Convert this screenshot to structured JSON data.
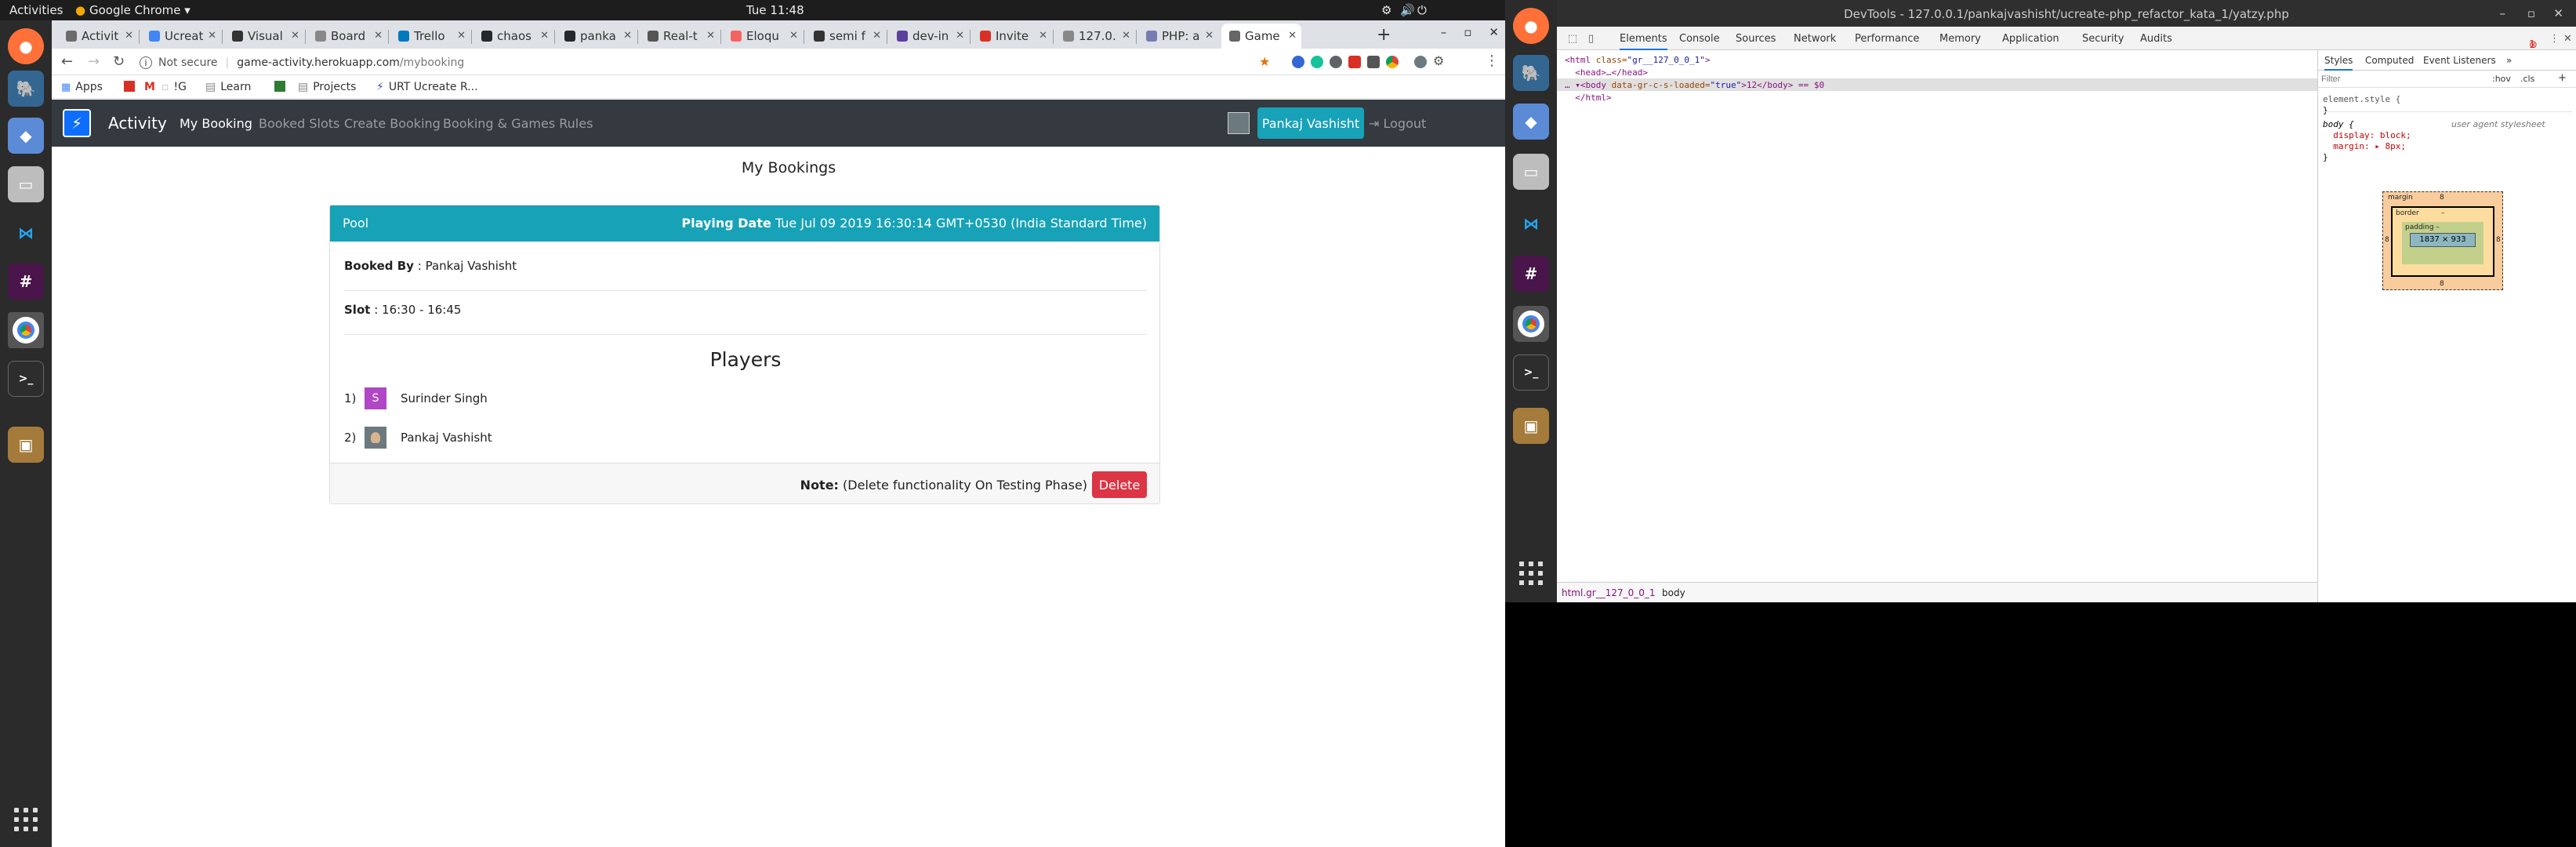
{
  "desktop": {
    "activities": "Activities",
    "app_menu": "Google Chrome ▾",
    "clock": "Tue 11:48"
  },
  "chrome": {
    "tabs": [
      {
        "label": "Activit",
        "color": "#6c6c6c"
      },
      {
        "label": "Ucreat",
        "color": "#4285f4"
      },
      {
        "label": "Visual",
        "color": "#333"
      },
      {
        "label": "Board",
        "color": "#888"
      },
      {
        "label": "Trello",
        "color": "#0079bf"
      },
      {
        "label": "chaos",
        "color": "#24292e"
      },
      {
        "label": "panka",
        "color": "#24292e"
      },
      {
        "label": "Real-t",
        "color": "#555"
      },
      {
        "label": "Eloqu",
        "color": "#f4645f"
      },
      {
        "label": "semi f",
        "color": "#333"
      },
      {
        "label": "dev-in",
        "color": "#5a3f9d"
      },
      {
        "label": "Invite",
        "color": "#d93025"
      },
      {
        "label": "127.0.",
        "color": "#888"
      },
      {
        "label": "PHP: a",
        "color": "#777bb3"
      },
      {
        "label": "Game",
        "color": "#666",
        "active": true
      }
    ],
    "url_security": "Not secure",
    "url_host": "game-activity.herokuapp.com",
    "url_path": "/mybooking",
    "bookmarks": [
      {
        "label": "Apps",
        "color": "#4285f4"
      },
      {
        "label": "",
        "color": "#d93025"
      },
      {
        "label": "",
        "color": "#d93025"
      },
      {
        "label": "!G",
        "color": "#999"
      },
      {
        "label": "Learn",
        "color": "#777"
      },
      {
        "label": "",
        "color": "#2e7d32"
      },
      {
        "label": "Projects",
        "color": "#777"
      },
      {
        "label": "URT Ucreate R...",
        "color": "#3f51b5"
      }
    ]
  },
  "app": {
    "brand": "Activity",
    "nav": [
      "My Booking",
      "Booked Slots",
      "Create Booking",
      "Booking & Games Rules"
    ],
    "user": "Pankaj Vashisht",
    "logout": "Logout",
    "page_title": "My Bookings",
    "booking": {
      "game": "Pool",
      "playing_date_label": "Playing Date",
      "playing_date": "Tue Jul 09 2019 16:30:14 GMT+0530 (India Standard Time)",
      "booked_by_label": "Booked By",
      "booked_by": ": Pankaj Vashisht",
      "slot_label": "Slot",
      "slot": ": 16:30 - 16:45",
      "players_heading": "Players",
      "players": [
        {
          "num": "1)",
          "initial": "S",
          "name": "Surinder Singh",
          "color": "#b047c4"
        },
        {
          "num": "2)",
          "initial": "",
          "name": "Pankaj Vashisht",
          "color": "#6c7a7f"
        }
      ],
      "note_label": "Note:",
      "note": "(Delete functionality On Testing Phase)",
      "delete_label": "Delete"
    }
  },
  "devtools": {
    "title": "DevTools - 127.0.0.1/pankajvashisht/ucreate-php_refactor_kata_1/yatzy.php",
    "tabs": [
      "Elements",
      "Console",
      "Sources",
      "Network",
      "Performance",
      "Memory",
      "Application",
      "Security",
      "Audits"
    ],
    "error_count": "1",
    "dom_lines": [
      {
        "open": "<html ",
        "attr": "class=",
        "val": "\"gr__127_0_0_1\"",
        "close": ">"
      },
      {
        "open": "  <head>…</head>",
        "attr": "",
        "val": "",
        "close": ""
      },
      {
        "open": "… ▾<body ",
        "attr": "data-gr-c-s-loaded=",
        "val": "\"true\"",
        "close": ">12</body> == $0"
      },
      {
        "open": "  </html>",
        "attr": "",
        "val": "",
        "close": ""
      }
    ],
    "breadcrumbs": [
      "html.gr__127_0_0_1",
      "body"
    ],
    "styles_tabs": [
      "Styles",
      "Computed",
      "Event Listeners",
      "»"
    ],
    "filter_placeholder": "Filter",
    "filter_hov": ":hov",
    "filter_cls": ".cls",
    "style_rules": [
      "element.style {",
      "}",
      "body {",
      "  display: block;",
      "  margin: ▸ 8px;",
      "}"
    ],
    "user_agent_label": "user agent stylesheet",
    "box_model": {
      "margin_label": "margin",
      "margin_value": "8",
      "border_label": "border",
      "border_value": "–",
      "padding_label": "padding –",
      "content": "1837 × 933"
    }
  }
}
